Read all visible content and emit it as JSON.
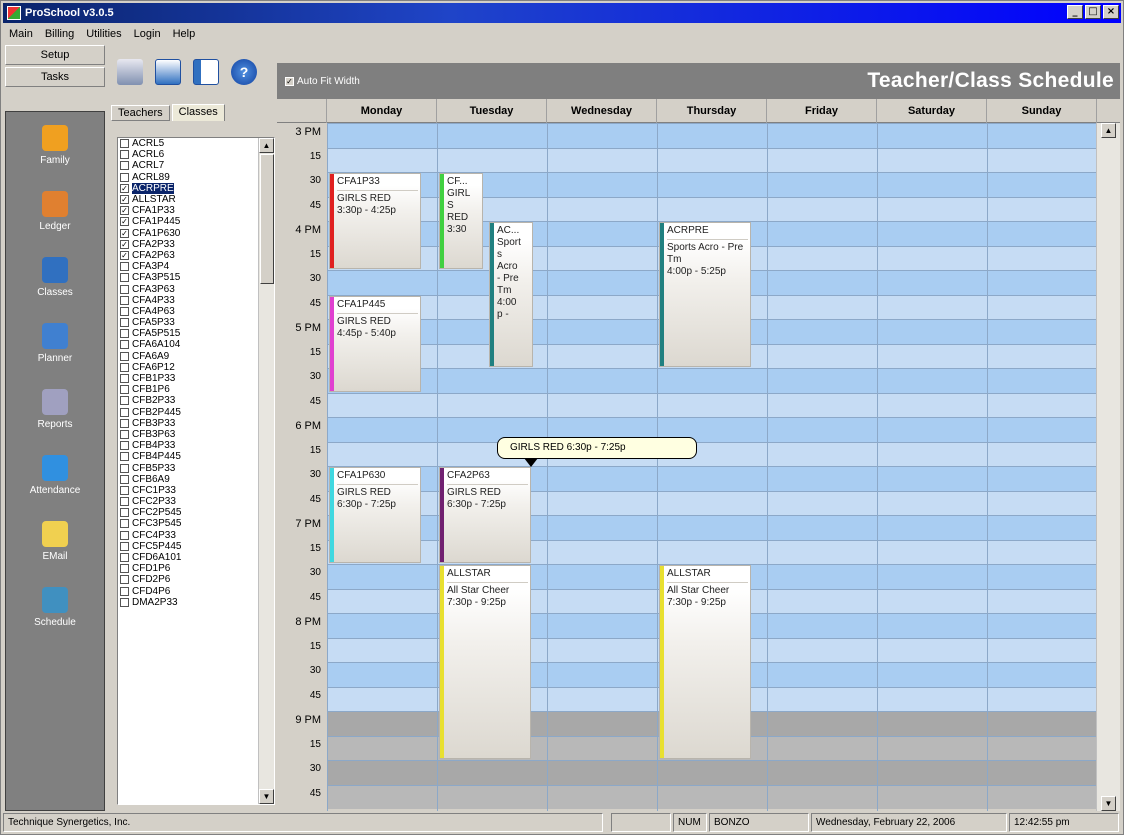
{
  "window": {
    "title": "ProSchool v3.0.5"
  },
  "menu": [
    "Main",
    "Billing",
    "Utilities",
    "Login",
    "Help"
  ],
  "nav": {
    "tabs": [
      "Setup",
      "Tasks"
    ],
    "items": [
      "Family",
      "Ledger",
      "Classes",
      "Planner",
      "Reports",
      "Attendance",
      "EMail",
      "Schedule"
    ]
  },
  "list": {
    "tabs": [
      "Teachers",
      "Classes"
    ],
    "items": [
      {
        "label": "ACRL5",
        "checked": false
      },
      {
        "label": "ACRL6",
        "checked": false
      },
      {
        "label": "ACRL7",
        "checked": false
      },
      {
        "label": "ACRL89",
        "checked": false
      },
      {
        "label": "ACRPRE",
        "checked": true,
        "selected": true
      },
      {
        "label": "ALLSTAR",
        "checked": true
      },
      {
        "label": "CFA1P33",
        "checked": true
      },
      {
        "label": "CFA1P445",
        "checked": true
      },
      {
        "label": "CFA1P630",
        "checked": true
      },
      {
        "label": "CFA2P33",
        "checked": true
      },
      {
        "label": "CFA2P63",
        "checked": true
      },
      {
        "label": "CFA3P4",
        "checked": false
      },
      {
        "label": "CFA3P515",
        "checked": false
      },
      {
        "label": "CFA3P63",
        "checked": false
      },
      {
        "label": "CFA4P33",
        "checked": false
      },
      {
        "label": "CFA4P63",
        "checked": false
      },
      {
        "label": "CFA5P33",
        "checked": false
      },
      {
        "label": "CFA5P515",
        "checked": false
      },
      {
        "label": "CFA6A104",
        "checked": false
      },
      {
        "label": "CFA6A9",
        "checked": false
      },
      {
        "label": "CFA6P12",
        "checked": false
      },
      {
        "label": "CFB1P33",
        "checked": false
      },
      {
        "label": "CFB1P6",
        "checked": false
      },
      {
        "label": "CFB2P33",
        "checked": false
      },
      {
        "label": "CFB2P445",
        "checked": false
      },
      {
        "label": "CFB3P33",
        "checked": false
      },
      {
        "label": "CFB3P63",
        "checked": false
      },
      {
        "label": "CFB4P33",
        "checked": false
      },
      {
        "label": "CFB4P445",
        "checked": false
      },
      {
        "label": "CFB5P33",
        "checked": false
      },
      {
        "label": "CFB6A9",
        "checked": false
      },
      {
        "label": "CFC1P33",
        "checked": false
      },
      {
        "label": "CFC2P33",
        "checked": false
      },
      {
        "label": "CFC2P545",
        "checked": false
      },
      {
        "label": "CFC3P545",
        "checked": false
      },
      {
        "label": "CFC4P33",
        "checked": false
      },
      {
        "label": "CFC5P445",
        "checked": false
      },
      {
        "label": "CFD6A101",
        "checked": false
      },
      {
        "label": "CFD1P6",
        "checked": false
      },
      {
        "label": "CFD2P6",
        "checked": false
      },
      {
        "label": "CFD4P6",
        "checked": false
      },
      {
        "label": "DMA2P33",
        "checked": false
      }
    ]
  },
  "schedule": {
    "auto_fit_label": "Auto Fit Width",
    "title": "Teacher/Class Schedule",
    "days": [
      "Monday",
      "Tuesday",
      "Wednesday",
      "Thursday",
      "Friday",
      "Saturday",
      "Sunday"
    ],
    "times": [
      "3 PM",
      "15",
      "30",
      "45",
      "4 PM",
      "15",
      "30",
      "45",
      "5 PM",
      "15",
      "30",
      "45",
      "6 PM",
      "15",
      "30",
      "45",
      "7 PM",
      "15",
      "30",
      "45",
      "8 PM",
      "15",
      "30",
      "45",
      "9 PM",
      "15",
      "30",
      "45"
    ],
    "appointments": [
      {
        "day": 0,
        "start": 2,
        "end": 6,
        "lines": [
          "CFA1P33",
          "GIRLS RED",
          "3:30p - 4:25p"
        ],
        "color": "#e02020",
        "sub": 0,
        "subs": 1
      },
      {
        "day": 1,
        "start": 2,
        "end": 6,
        "lines": [
          "CF...",
          "GIRL",
          "S",
          "RED",
          "3:30"
        ],
        "color": "#40d040",
        "sub": 0,
        "subs": 2
      },
      {
        "day": 1,
        "start": 4,
        "end": 10,
        "lines": [
          "AC...",
          "Sport",
          "s",
          "Acro",
          "- Pre",
          "Tm",
          "4:00",
          "p -"
        ],
        "color": "#208080",
        "sub": 1,
        "subs": 2
      },
      {
        "day": 3,
        "start": 4,
        "end": 10,
        "lines": [
          "ACRPRE",
          "Sports Acro - Pre Tm",
          "4:00p - 5:25p"
        ],
        "color": "#208080",
        "sub": 0,
        "subs": 1
      },
      {
        "day": 0,
        "start": 7,
        "end": 11,
        "lines": [
          "CFA1P445",
          "GIRLS RED",
          "4:45p - 5:40p"
        ],
        "color": "#e040d0",
        "sub": 0,
        "subs": 1
      },
      {
        "day": 0,
        "start": 14,
        "end": 18,
        "lines": [
          "CFA1P630",
          "GIRLS RED",
          "6:30p - 7:25p"
        ],
        "color": "#40d8e0",
        "sub": 0,
        "subs": 1
      },
      {
        "day": 1,
        "start": 14,
        "end": 18,
        "lines": [
          "CFA2P63",
          "GIRLS RED",
          "6:30p - 7:25p"
        ],
        "color": "#702070",
        "sub": 0,
        "subs": 1
      },
      {
        "day": 1,
        "start": 18,
        "end": 26,
        "lines": [
          "ALLSTAR",
          "All Star Cheer",
          "7:30p - 9:25p"
        ],
        "color": "#e8e030",
        "sub": 0,
        "subs": 1
      },
      {
        "day": 3,
        "start": 18,
        "end": 26,
        "lines": [
          "ALLSTAR",
          "All Star Cheer",
          "7:30p - 9:25p"
        ],
        "color": "#e8e030",
        "sub": 0,
        "subs": 1
      }
    ],
    "tooltip": "GIRLS RED 6:30p - 7:25p"
  },
  "status": {
    "company": "Technique Synergetics, Inc.",
    "numlock": "NUM",
    "user": "BONZO",
    "date": "Wednesday, February 22, 2006",
    "time": "12:42:55 pm"
  }
}
